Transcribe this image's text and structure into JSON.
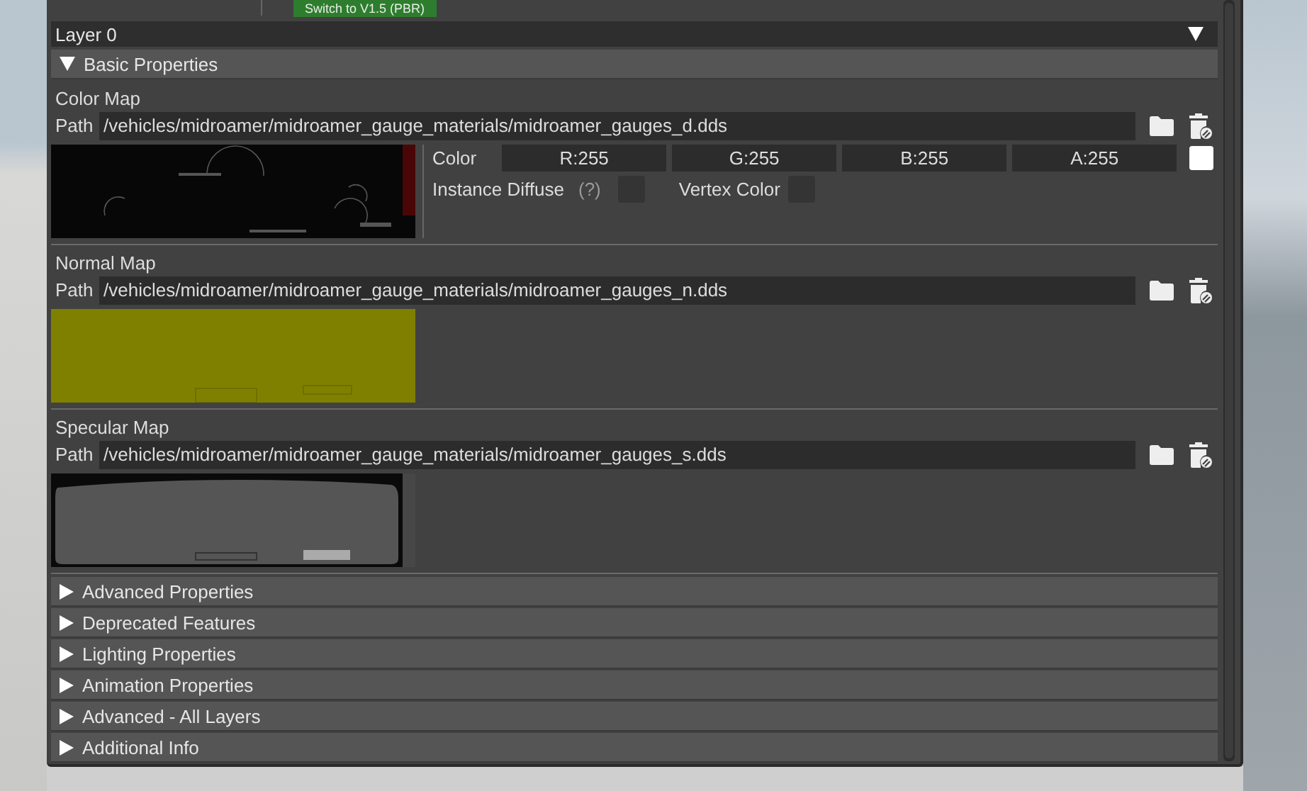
{
  "top_button": {
    "label": "Switch to V1.5 (PBR)"
  },
  "layer_dropdown": {
    "value": "Layer 0"
  },
  "basic_properties": {
    "title": "Basic Properties",
    "expanded": true,
    "maps": [
      {
        "title": "Color Map",
        "path_label": "Path",
        "path": "/vehicles/midroamer/midroamer_gauge_materials/midroamer_gauges_d.dds",
        "kind": "gauges",
        "color": {
          "label": "Color",
          "channels": [
            "R:255",
            "G:255",
            "B:255",
            "A:255"
          ],
          "swatch": {
            "color": "#ffffff"
          },
          "instance_diffuse": {
            "label": "Instance Diffuse",
            "help": "(?)",
            "checked": false
          },
          "vertex_color": {
            "label": "Vertex Color",
            "checked": false
          }
        }
      },
      {
        "title": "Normal Map",
        "path_label": "Path",
        "path": "/vehicles/midroamer/midroamer_gauge_materials/midroamer_gauges_n.dds",
        "kind": "normal"
      },
      {
        "title": "Specular Map",
        "path_label": "Path",
        "path": "/vehicles/midroamer/midroamer_gauge_materials/midroamer_gauges_s.dds",
        "kind": "specular"
      }
    ]
  },
  "sections": [
    {
      "title": "Advanced Properties",
      "expanded": false
    },
    {
      "title": "Deprecated Features",
      "expanded": false
    },
    {
      "title": "Lighting Properties",
      "expanded": false
    },
    {
      "title": "Animation Properties",
      "expanded": false
    },
    {
      "title": "Advanced - All Layers",
      "expanded": false
    },
    {
      "title": "Additional Info",
      "expanded": false
    }
  ]
}
